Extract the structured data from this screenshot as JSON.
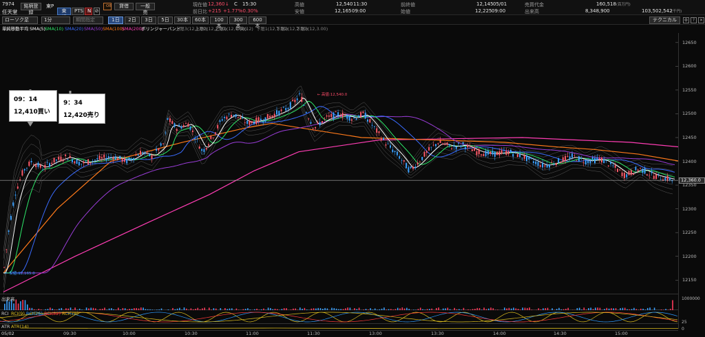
{
  "header": {
    "code": "7974",
    "name": "任天堂",
    "market_tag": "東P",
    "buttons": {
      "favorite": "銘柄登録",
      "market": "東証",
      "pts": "PTS",
      "n": "N",
      "lending": "貸借",
      "general": "一般売"
    },
    "orange_tag": "OB",
    "labels": {
      "current": "現在値",
      "prev_diff": "前日比",
      "high": "高値",
      "low": "安値",
      "prev_close": "前終値",
      "open": "始値",
      "value": "売買代金",
      "volume": "出来高"
    },
    "values": {
      "current": "12,360",
      "arrow": "↓",
      "c_flag": "C",
      "time": "15:30",
      "prev_diff": "+215",
      "prev_pct": "+1.77%",
      "prev_pct2": "-0.30%",
      "high": "12,540",
      "high_time": "11:30",
      "low": "12,165",
      "low_time": "09:00",
      "prev_close": "12,145",
      "prev_close_date": "05/01",
      "open": "12,225",
      "open_time": "09:00",
      "value": "160,518",
      "value_unit": "(百万円)",
      "volume": "8,348,900",
      "volume_total": "103,502,542",
      "volume_unit": "(千円)"
    }
  },
  "toolbar": {
    "chart_type": "ローソク足",
    "interval": "1分",
    "period_placeholder": "期間指定",
    "ranges": [
      "1日",
      "2日",
      "3日",
      "5日",
      "30本",
      "60本",
      "100本",
      "300本",
      "600本"
    ],
    "technical": "テクニカル",
    "icons": [
      "⚙",
      "?",
      "✕"
    ]
  },
  "indicators": [
    {
      "text": "単純移動平均",
      "color": "#ffffff"
    },
    {
      "text": "SMA(5)",
      "color": "#ffffff"
    },
    {
      "text": "SMA(10)",
      "color": "#2ee86a"
    },
    {
      "text": "SMA(20)",
      "color": "#3a6cff"
    },
    {
      "text": "SMA(50)",
      "color": "#9a3dd8"
    },
    {
      "text": "SMA(100)",
      "color": "#ff7a1a"
    },
    {
      "text": "SMA(200)",
      "color": "#ff3db4"
    },
    {
      "text": "ボリンジャーバンド",
      "color": "#ffffff"
    },
    {
      "text": "上限3(12,3.00)",
      "color": "#888888"
    },
    {
      "text": "上限2(12,2.00)",
      "color": "#888888"
    },
    {
      "text": "上限1(12,1.00)",
      "color": "#888888"
    },
    {
      "text": "中央(12)",
      "color": "#888888"
    },
    {
      "text": "下限1(12,1.00)",
      "color": "#888888"
    },
    {
      "text": "下限2(12,2.00)",
      "color": "#888888"
    },
    {
      "text": "下限3(12,3.00)",
      "color": "#888888"
    }
  ],
  "annotations": {
    "high_mark": "高値:12,540.0",
    "low_mark": "安値:12,165.0",
    "current_price": "12,360.0",
    "callout1_time": "09：14",
    "callout1_text": "12,410買い",
    "callout2_time": "9：34",
    "callout2_text": "12,420売り"
  },
  "subpanels": {
    "volume_label": "出来高",
    "volume_axis": "1000000",
    "rci_label": "RCI",
    "rci_items": [
      {
        "text": "RCI(9)",
        "color": "#e0c020"
      },
      {
        "text": "RCI(26)",
        "color": "#2e9aff"
      },
      {
        "text": "RCI(52)",
        "color": "#ff3a3a"
      },
      {
        "text": "RCI(78)",
        "color": "#e0c020"
      }
    ],
    "rci_axis_top": "",
    "rci_axis_bottom": "",
    "atr_label": "ATR",
    "atr_item": "ATR(14)",
    "atr_axis_top": "25",
    "atr_axis_bottom": "0"
  },
  "date_label": "05/02",
  "x_labels": [
    "09:30",
    "10:00",
    "10:30",
    "11:00",
    "11:30",
    "13:00",
    "13:30",
    "14:00",
    "14:30",
    "15:00"
  ],
  "chart_data": {
    "type": "candlestick",
    "y_ticks": [
      12150,
      12200,
      12250,
      12300,
      12350,
      12400,
      12450,
      12500,
      12550,
      12600,
      12650
    ],
    "ylim": [
      12120,
      12670
    ],
    "high": 12540,
    "low": 12165,
    "current": 12360,
    "sma100_approx": [
      [
        0,
        12165
      ],
      [
        60,
        12300
      ],
      [
        120,
        12400
      ],
      [
        200,
        12440
      ],
      [
        270,
        12470
      ],
      [
        300,
        12480
      ],
      [
        400,
        12450
      ],
      [
        560,
        12440
      ],
      [
        620,
        12430
      ],
      [
        660,
        12425
      ],
      [
        710,
        12415
      ],
      [
        756,
        12400
      ]
    ],
    "sma200_approx": [
      [
        0,
        12125
      ],
      [
        80,
        12200
      ],
      [
        160,
        12270
      ],
      [
        230,
        12330
      ],
      [
        280,
        12380
      ],
      [
        330,
        12420
      ],
      [
        420,
        12445
      ],
      [
        580,
        12450
      ],
      [
        640,
        12445
      ],
      [
        700,
        12440
      ],
      [
        756,
        12430
      ]
    ],
    "price_path": [
      [
        0,
        12165
      ],
      [
        8,
        12260
      ],
      [
        16,
        12330
      ],
      [
        28,
        12380
      ],
      [
        40,
        12400
      ],
      [
        55,
        12385
      ],
      [
        70,
        12400
      ],
      [
        90,
        12410
      ],
      [
        110,
        12395
      ],
      [
        135,
        12405
      ],
      [
        155,
        12410
      ],
      [
        175,
        12400
      ],
      [
        195,
        12420
      ],
      [
        210,
        12410
      ],
      [
        228,
        12440
      ],
      [
        232,
        12490
      ],
      [
        245,
        12470
      ],
      [
        262,
        12480
      ],
      [
        272,
        12450
      ],
      [
        282,
        12420
      ],
      [
        295,
        12450
      ],
      [
        310,
        12490
      ],
      [
        325,
        12500
      ],
      [
        345,
        12480
      ],
      [
        370,
        12490
      ],
      [
        400,
        12510
      ],
      [
        415,
        12530
      ],
      [
        420,
        12540
      ],
      [
        430,
        12500
      ],
      [
        440,
        12470
      ],
      [
        455,
        12490
      ],
      [
        475,
        12500
      ],
      [
        495,
        12490
      ],
      [
        510,
        12500
      ],
      [
        525,
        12470
      ],
      [
        540,
        12440
      ],
      [
        560,
        12410
      ],
      [
        575,
        12380
      ],
      [
        585,
        12395
      ],
      [
        600,
        12420
      ],
      [
        615,
        12440
      ],
      [
        635,
        12430
      ],
      [
        650,
        12435
      ],
      [
        670,
        12420
      ],
      [
        690,
        12415
      ],
      [
        715,
        12420
      ],
      [
        735,
        12410
      ],
      [
        750,
        12400
      ],
      [
        765,
        12390
      ],
      [
        785,
        12400
      ],
      [
        805,
        12410
      ],
      [
        825,
        12400
      ],
      [
        845,
        12405
      ],
      [
        862,
        12390
      ],
      [
        880,
        12370
      ],
      [
        900,
        12385
      ],
      [
        920,
        12370
      ],
      [
        935,
        12365
      ],
      [
        950,
        12360
      ]
    ]
  }
}
